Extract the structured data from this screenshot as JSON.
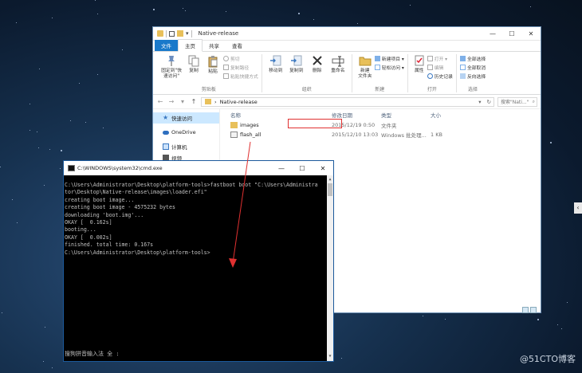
{
  "explorer": {
    "title": "Native-release",
    "quick_access_dropdown": "▾",
    "controls": {
      "minimize": "—",
      "maximize": "☐",
      "close": "✕"
    },
    "tabs": [
      {
        "label": "文件"
      },
      {
        "label": "主页"
      },
      {
        "label": "共享"
      },
      {
        "label": "查看"
      }
    ],
    "ribbon": {
      "clipboard": {
        "name": "剪贴板",
        "pin": "固定到\"快\n速访问\"",
        "copy": "复制",
        "paste": "粘贴",
        "cut": "剪切",
        "copy_path": "复制路径",
        "paste_shortcut": "粘贴快捷方式"
      },
      "organize": {
        "name": "组织",
        "move_to": "移动到",
        "copy_to": "复制到",
        "delete": "删除",
        "rename": "重命名"
      },
      "new": {
        "name": "新建",
        "new_folder": "新建\n文件夹",
        "new_item": "新建项目 ▾",
        "easy_access": "轻松访问 ▾"
      },
      "open": {
        "name": "打开",
        "properties": "属性",
        "open": "打开 ▾",
        "edit": "编辑",
        "history": "历史记录"
      },
      "select": {
        "name": "选择",
        "select_all": "全部选择",
        "select_none": "全部取消",
        "invert": "反向选择"
      }
    },
    "address": {
      "path": "Native-release",
      "search_placeholder": "搜索\"Nati...\"",
      "back": "←",
      "forward": "→",
      "recent": "▾",
      "up": "↑",
      "refresh": "↻"
    },
    "nav_pane": [
      {
        "label": "快速访问",
        "icon": "star-icon"
      },
      {
        "label": "OneDrive",
        "icon": "cloud-icon"
      },
      {
        "label": "计算机",
        "icon": "computer-icon"
      },
      {
        "label": "视频",
        "icon": "video-icon"
      }
    ],
    "columns": {
      "name": "名称",
      "date": "修改日期",
      "type": "类型",
      "size": "大小"
    },
    "files": [
      {
        "name": "images",
        "date": "2015/12/19 0:50",
        "type": "文件夹",
        "size": "",
        "icon": "folder-icon"
      },
      {
        "name": "flash_all",
        "date": "2015/12/10 13:03",
        "type": "Windows 批处理...",
        "size": "1 KB",
        "icon": "batch-file-icon"
      }
    ]
  },
  "cmd": {
    "title": "C:\\WINDOWS\\system32\\cmd.exe",
    "controls": {
      "minimize": "—",
      "maximize": "☐",
      "close": "✕"
    },
    "lines": [
      "C:\\Users\\Administrator\\Desktop\\platform-tools>fastboot boot \"C:\\Users\\Administra",
      "tor\\Desktop\\Native-release\\images\\loader.efi\"",
      "creating boot image...",
      "creating boot image - 4575232 bytes",
      "downloading 'boot.img'...",
      "OKAY [  0.162s]",
      "booting...",
      "OKAY [  0.002s]",
      "finished. total time: 0.167s",
      "",
      "C:\\Users\\Administrator\\Desktop\\platform-tools>"
    ],
    "ime_status": "搜狗拼音输入法 全 :"
  },
  "watermark": "@51CTO博客",
  "colors": {
    "highlight": "#e03030",
    "ribbon_file_tab": "#1979ca",
    "cmd_bg": "#000000"
  }
}
